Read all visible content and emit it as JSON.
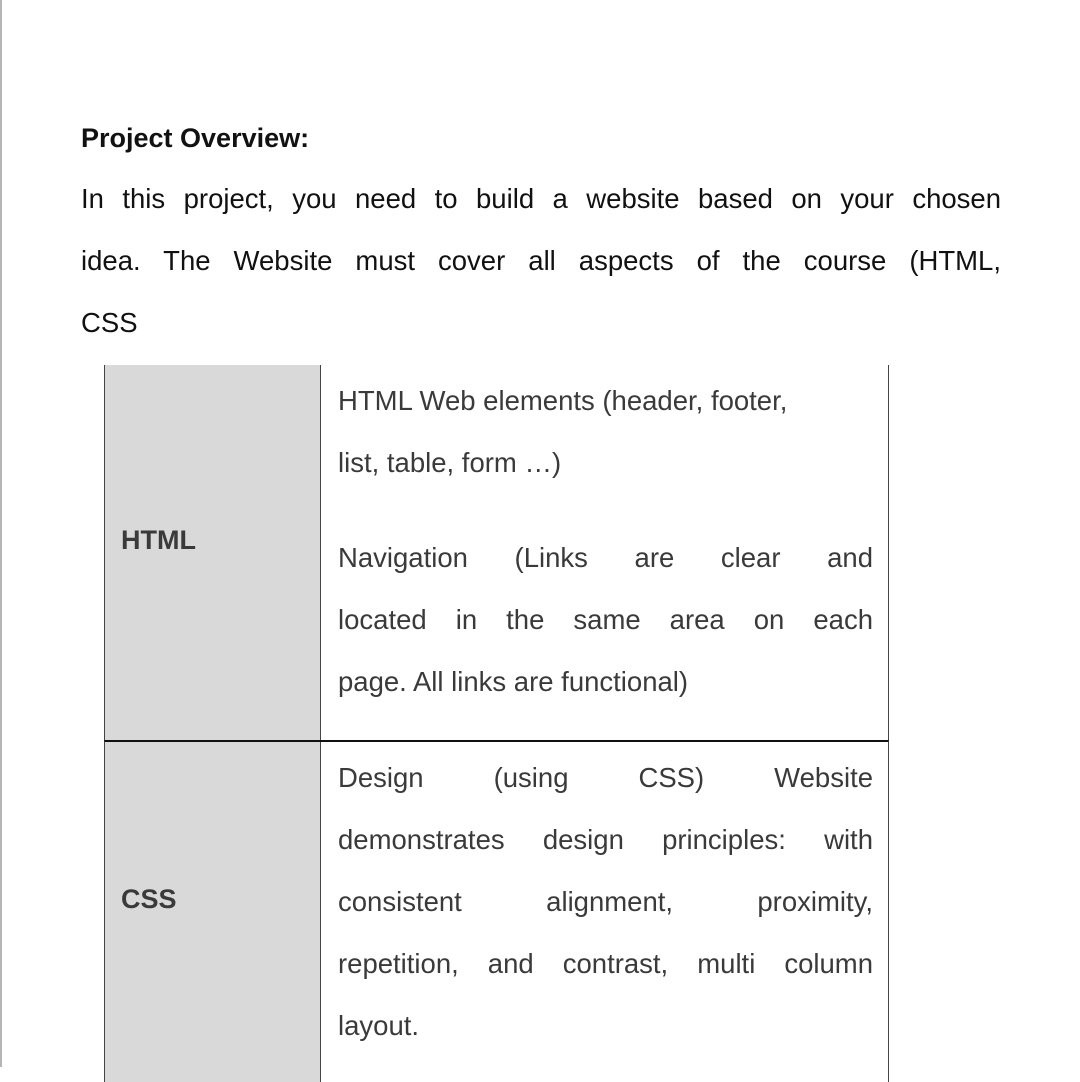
{
  "document": {
    "heading": "Project Overview:",
    "intro_lines": [
      "In this project, you need to build a website based on your chosen",
      "idea. The Website must cover all aspects of the course (HTML,",
      "CSS"
    ]
  },
  "table": {
    "header_fill": "#d9d9d9",
    "rows": [
      {
        "label": "HTML",
        "items": [
          {
            "lines": [
              "HTML Web elements (header, footer,",
              "list, table, form …)"
            ]
          },
          {
            "lines": [
              "Navigation (Links are clear and",
              "located in the same area on each",
              "page. All links are functional)"
            ]
          }
        ]
      },
      {
        "label": "CSS",
        "items": [
          {
            "lines": [
              "Design (using CSS) Website",
              "demonstrates design principles: with",
              "consistent alignment, proximity,",
              "repetition, and contrast, multi column",
              "layout."
            ]
          }
        ]
      }
    ]
  }
}
